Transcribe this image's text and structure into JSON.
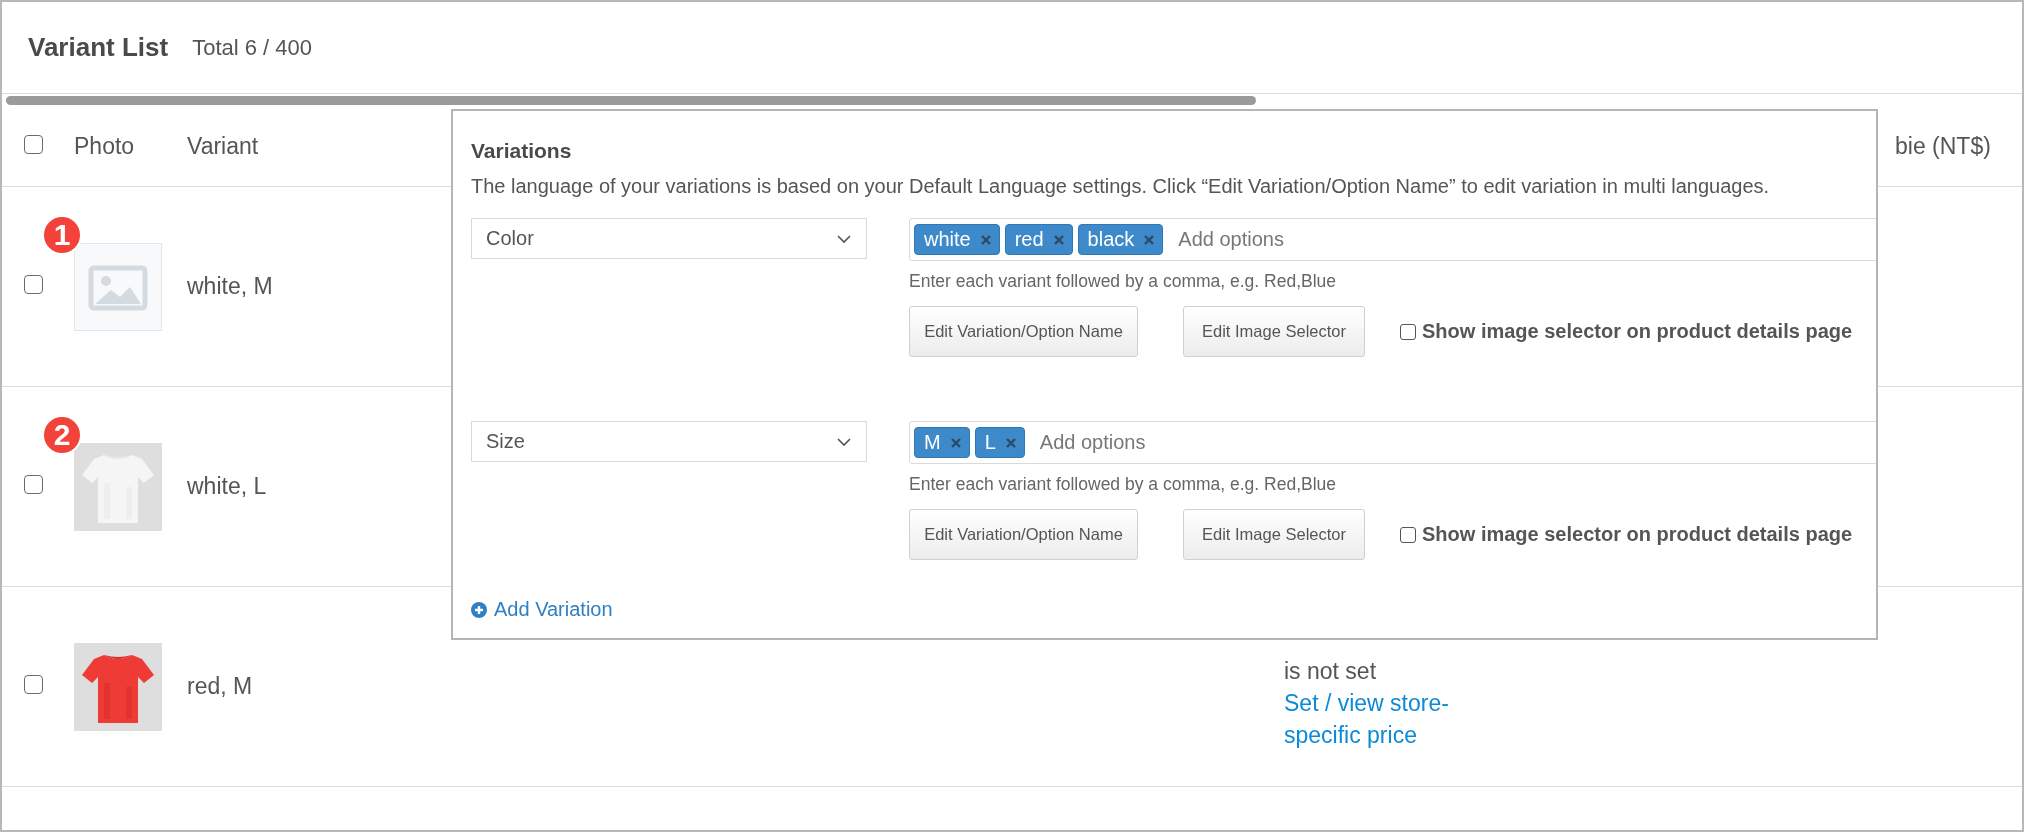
{
  "header": {
    "title": "Variant List",
    "total": "Total 6 / 400"
  },
  "table": {
    "select_all": {
      "checked": false
    },
    "columns": [
      "Photo",
      "Variant",
      "bie (NT$)"
    ],
    "rows": [
      {
        "checked": false,
        "badge": "1",
        "photo": {
          "kind": "placeholder"
        },
        "variant": "white, M"
      },
      {
        "checked": false,
        "badge": "2",
        "variant": "white, L"
      },
      {
        "checked": false,
        "variant": "red, M",
        "price_note": "is not set",
        "price_link": "Set / view store-specific price"
      }
    ]
  },
  "variations_popup": {
    "title": "Variations",
    "description": "The language of your variations is based on your Default Language settings. Click “Edit Variation/Option Name” to edit variation in multi languages.",
    "variations": [
      {
        "name": "Color",
        "options": [
          "white",
          "red",
          "black"
        ],
        "placeholder": "Add options",
        "hint": "Enter each variant followed by a comma, e.g. Red,Blue",
        "buttons": [
          "Edit Variation/Option Name",
          "Edit Image Selector"
        ],
        "image_selector": {
          "label": "Show image selector on product details page",
          "checked": false
        }
      },
      {
        "name": "Size",
        "options": [
          "M",
          "L"
        ],
        "placeholder": "Add options",
        "hint": "Enter each variant followed by a comma, e.g. Red,Blue",
        "buttons": [
          "Edit Variation/Option Name",
          "Edit Image Selector"
        ],
        "image_selector": {
          "label": "Show image selector on product details page",
          "checked": false
        }
      }
    ],
    "add_link": "Add Variation"
  }
}
